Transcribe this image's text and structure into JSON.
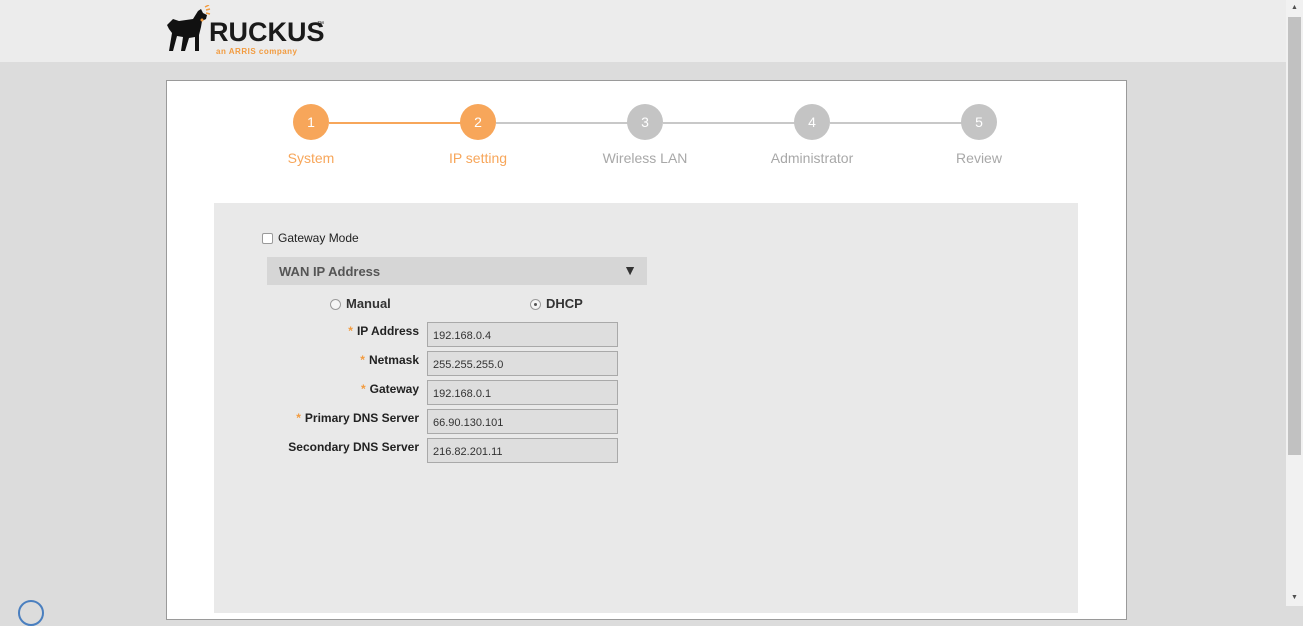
{
  "brand": {
    "name": "RUCKUS",
    "tm": "™",
    "tagline": "an ARRIS company",
    "colors": {
      "orange": "#f29b3f",
      "step_done": "#f7a65a",
      "step_todo": "#c4c4c4"
    }
  },
  "steps": [
    {
      "number": "1",
      "label": "System",
      "state": "done"
    },
    {
      "number": "2",
      "label": "IP setting",
      "state": "done"
    },
    {
      "number": "3",
      "label": "Wireless LAN",
      "state": "todo"
    },
    {
      "number": "4",
      "label": "Administrator",
      "state": "todo"
    },
    {
      "number": "5",
      "label": "Review",
      "state": "todo"
    }
  ],
  "form": {
    "gateway_mode_label": "Gateway Mode",
    "gateway_mode_checked": false,
    "wan_section_title": "WAN IP Address",
    "wan_section_icon": "caret-down-icon",
    "mode_manual_label": "Manual",
    "mode_dhcp_label": "DHCP",
    "selected_mode": "DHCP",
    "required_marker": "*",
    "fields": {
      "ip_address": {
        "label": "IP Address",
        "value": "192.168.0.4",
        "required": true
      },
      "netmask": {
        "label": "Netmask",
        "value": "255.255.255.0",
        "required": true
      },
      "gateway": {
        "label": "Gateway",
        "value": "192.168.0.1",
        "required": true
      },
      "primary_dns": {
        "label": "Primary DNS Server",
        "value": "66.90.130.101",
        "required": true
      },
      "secondary_dns": {
        "label": "Secondary DNS Server",
        "value": "216.82.201.11",
        "required": false
      }
    }
  }
}
